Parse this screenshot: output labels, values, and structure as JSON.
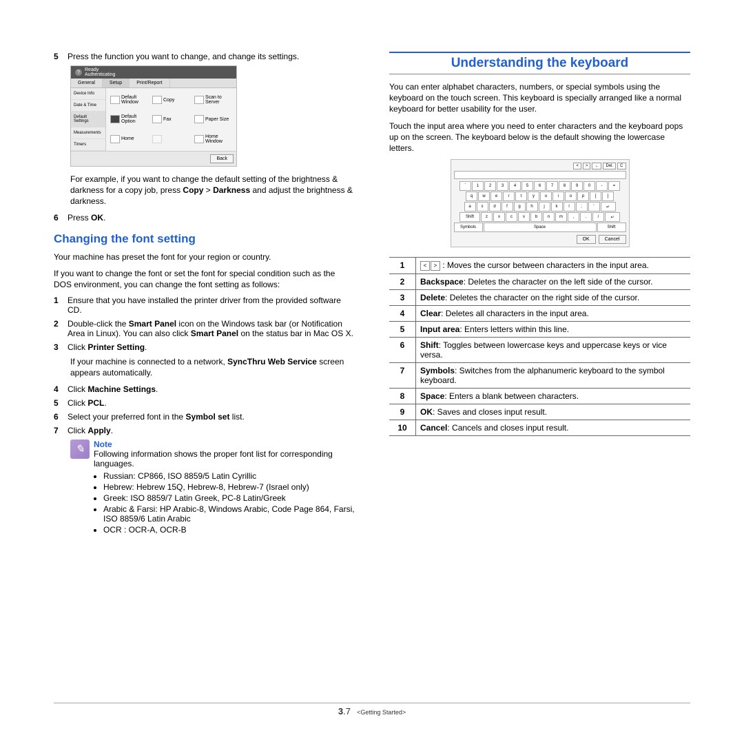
{
  "left": {
    "step5": "Press the function you want to change, and change its settings.",
    "panel": {
      "status1": "Ready",
      "status2": "Authenticating",
      "tabs": [
        "General",
        "Setup",
        "Print/Report"
      ],
      "side": [
        "Device Info",
        "Date & Time",
        "Default Settings",
        "Measurements",
        "Timers"
      ],
      "grid": [
        "Default Window",
        "Copy",
        "Scan to Server",
        "Default Option",
        "Fax",
        "Paper Size",
        "Home",
        "",
        "Home Window"
      ],
      "back": "Back"
    },
    "example": {
      "pre": "For example, if you want to change the default setting of the brightness & darkness for a copy job, press ",
      "b1": "Copy",
      "mid": " > ",
      "b2": "Darkness",
      "post": " and adjust the brightness & darkness."
    },
    "step6": {
      "pre": "Press ",
      "b": "OK",
      "post": "."
    },
    "heading": "Changing the font setting",
    "intro1": "Your machine has preset the font for your region or country.",
    "intro2": "If you want to change the font or set the font for special condition such as the DOS environment, you can change the font setting as follows:",
    "s1": "Ensure that you have installed the printer driver from the provided software CD.",
    "s2": {
      "pre": "Double-click the ",
      "b1": "Smart Panel",
      "mid": " icon on the Windows task bar (or Notification Area in Linux). You can also click ",
      "b2": "Smart Panel",
      "post": " on the status bar in Mac OS X."
    },
    "s3": {
      "pre": "Click ",
      "b": "Printer Setting",
      "post": "."
    },
    "s3b": {
      "pre": "If your machine is connected to a network, ",
      "b": "SyncThru Web Service",
      "post": " screen appears automatically."
    },
    "s4": {
      "pre": "Click ",
      "b": "Machine Settings",
      "post": "."
    },
    "s5": {
      "pre": "Click ",
      "b": "PCL",
      "post": "."
    },
    "s6": {
      "pre": "Select your preferred font in the ",
      "b": "Symbol set",
      "post": " list."
    },
    "s7": {
      "pre": "Click ",
      "b": "Apply",
      "post": "."
    },
    "note": {
      "title": "Note",
      "lead": "Following information shows the proper font list for corresponding languages.",
      "items": [
        "Russian: CP866, ISO 8859/5 Latin Cyrillic",
        "Hebrew: Hebrew 15Q, Hebrew-8, Hebrew-7 (Israel only)",
        "Greek: ISO 8859/7 Latin Greek, PC-8 Latin/Greek",
        "Arabic & Farsi: HP Arabic-8, Windows Arabic, Code Page 864, Farsi, ISO 8859/6 Latin Arabic",
        "OCR : OCR-A, OCR-B"
      ]
    }
  },
  "right": {
    "heading": "Understanding the keyboard",
    "p1": "You can enter alphabet characters, numbers, or special symbols using the keyboard on the touch screen. This keyboard is specially arranged like a normal keyboard for better usability for the user.",
    "p2": "Touch the input area where you need to enter characters and the keyboard pops up on the screen. The keyboard below is the default showing the lowercase letters.",
    "kb": {
      "top": [
        "<",
        ">",
        "←",
        "Del.",
        "C"
      ],
      "row1": [
        "`",
        "1",
        "2",
        "3",
        "4",
        "5",
        "6",
        "7",
        "8",
        "9",
        "0",
        "-",
        "="
      ],
      "row2": [
        "q",
        "w",
        "e",
        "r",
        "t",
        "y",
        "u",
        "i",
        "o",
        "p",
        "[",
        "]"
      ],
      "row3": [
        "a",
        "s",
        "d",
        "f",
        "g",
        "h",
        "j",
        "k",
        "l",
        ";",
        "'"
      ],
      "row4": [
        "Shift",
        "z",
        "x",
        "c",
        "v",
        "b",
        "n",
        "m",
        ",",
        ".",
        "/"
      ],
      "row5": [
        "Symbols",
        "Space",
        "Shift"
      ],
      "ok": "OK",
      "cancel": "Cancel"
    },
    "table": [
      {
        "n": "1",
        "arrows": true,
        "text": ": Moves the cursor between characters in the input area."
      },
      {
        "n": "2",
        "b": "Backspace",
        "text": ": Deletes the character on the left side of the cursor."
      },
      {
        "n": "3",
        "b": "Delete",
        "text": ": Deletes the character on the right side of the cursor."
      },
      {
        "n": "4",
        "b": "Clear",
        "text": ": Deletes all characters in the input area."
      },
      {
        "n": "5",
        "b": "Input area",
        "text": ": Enters letters within this line."
      },
      {
        "n": "6",
        "b": "Shift",
        "text": ": Toggles between lowercase keys and uppercase keys or vice versa."
      },
      {
        "n": "7",
        "b": "Symbols",
        "text": ": Switches from the alphanumeric keyboard to the symbol keyboard."
      },
      {
        "n": "8",
        "b": "Space",
        "text": ": Enters a blank between characters."
      },
      {
        "n": "9",
        "b": "OK",
        "text": ": Saves and closes input result."
      },
      {
        "n": "10",
        "b": "Cancel",
        "text": ": Cancels and closes input result."
      }
    ]
  },
  "footer": {
    "chapter": "3",
    "page": ".7",
    "section": "<Getting Started>"
  }
}
